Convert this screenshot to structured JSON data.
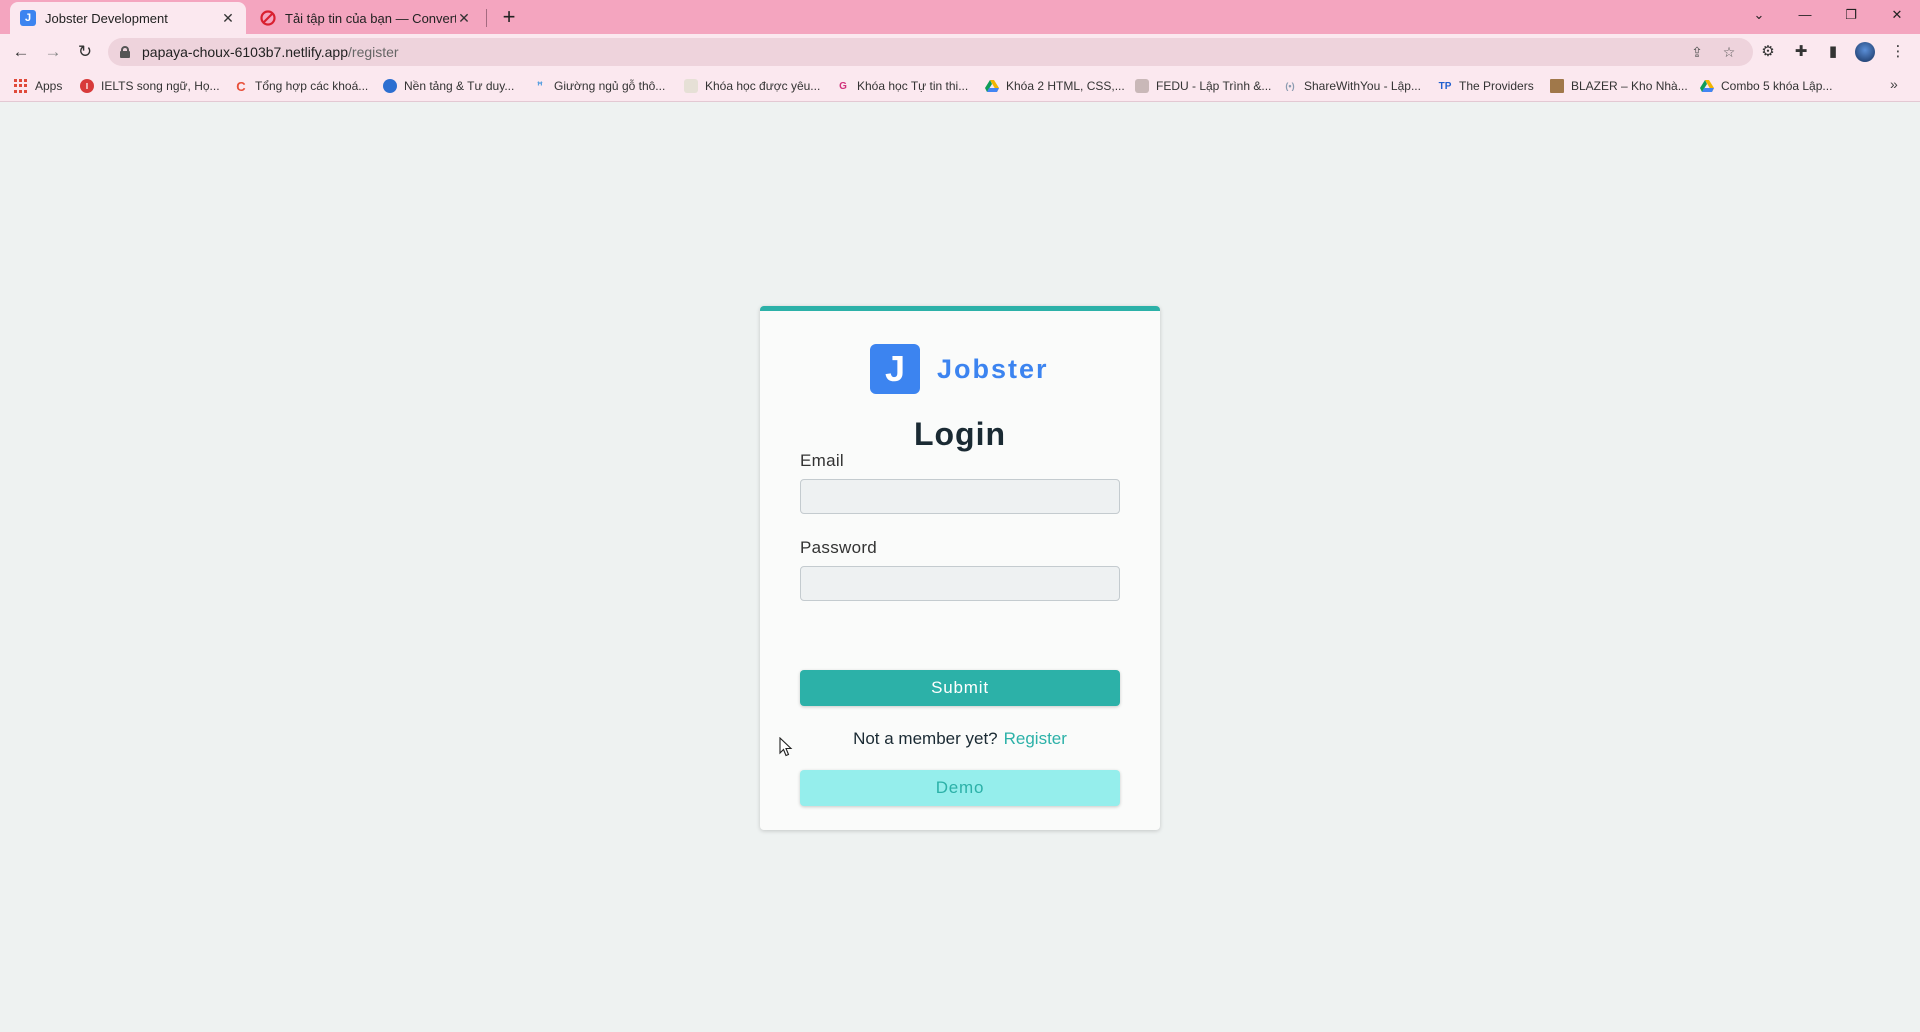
{
  "browser": {
    "tabs": [
      {
        "title": "Jobster Development",
        "favicon": "J",
        "active": true
      },
      {
        "title": "Tải tập tin của bạn — Convertio",
        "favicon": "convertio-icon",
        "active": false
      }
    ],
    "url_host": "papaya-choux-6103b7.netlify.app",
    "url_path": "/register",
    "bookmarks": [
      {
        "label": "Apps",
        "icon": "apps-grid-icon"
      },
      {
        "label": "IELTS song ngữ, Họ...",
        "icon": "ielts-icon",
        "color": "#d83a3a"
      },
      {
        "label": "Tổng hợp các khoá...",
        "icon": "c-icon",
        "color": "#e8503a"
      },
      {
        "label": "Nền tảng & Tư duy...",
        "icon": "globe-icon",
        "color": "#2c6fd1"
      },
      {
        "label": "Giường ngủ gỗ thô...",
        "icon": "bed-icon",
        "color": "#5aa0e0"
      },
      {
        "label": "Khóa học được yêu...",
        "icon": "blank-page-icon",
        "color": "#e6e0d6"
      },
      {
        "label": "Khóa học Tự tin thi...",
        "icon": "pink-logo-icon",
        "color": "#d0307a"
      },
      {
        "label": "Khóa 2 HTML, CSS,...",
        "icon": "drive-icon",
        "color": "#f2b400"
      },
      {
        "label": "FEDU - Lập Trình &...",
        "icon": "fedu-icon",
        "color": "#c9b8b8"
      },
      {
        "label": "ShareWithYou - Lập...",
        "icon": "share-icon",
        "color": "#8a9bb0"
      },
      {
        "label": "The Providers",
        "icon": "tp-icon",
        "color": "#1f5fcf"
      },
      {
        "label": "BLAZER – Kho Nhà...",
        "icon": "blazer-icon",
        "color": "#a0784a"
      },
      {
        "label": "Combo 5 khóa Lập...",
        "icon": "drive-icon",
        "color": "#f2b400"
      }
    ]
  },
  "app": {
    "logo_letter": "J",
    "logo_text": "Jobster",
    "form_title": "Login",
    "email_label": "Email",
    "email_value": "",
    "password_label": "Password",
    "password_value": "",
    "submit_label": "Submit",
    "member_text": "Not a member yet?",
    "register_link": "Register",
    "demo_label": "Demo"
  },
  "colors": {
    "primary": "#3c84f0",
    "accent": "#2cb1a8",
    "demo_bg": "#95eeec",
    "tab_bar": "#f4a5bf"
  }
}
